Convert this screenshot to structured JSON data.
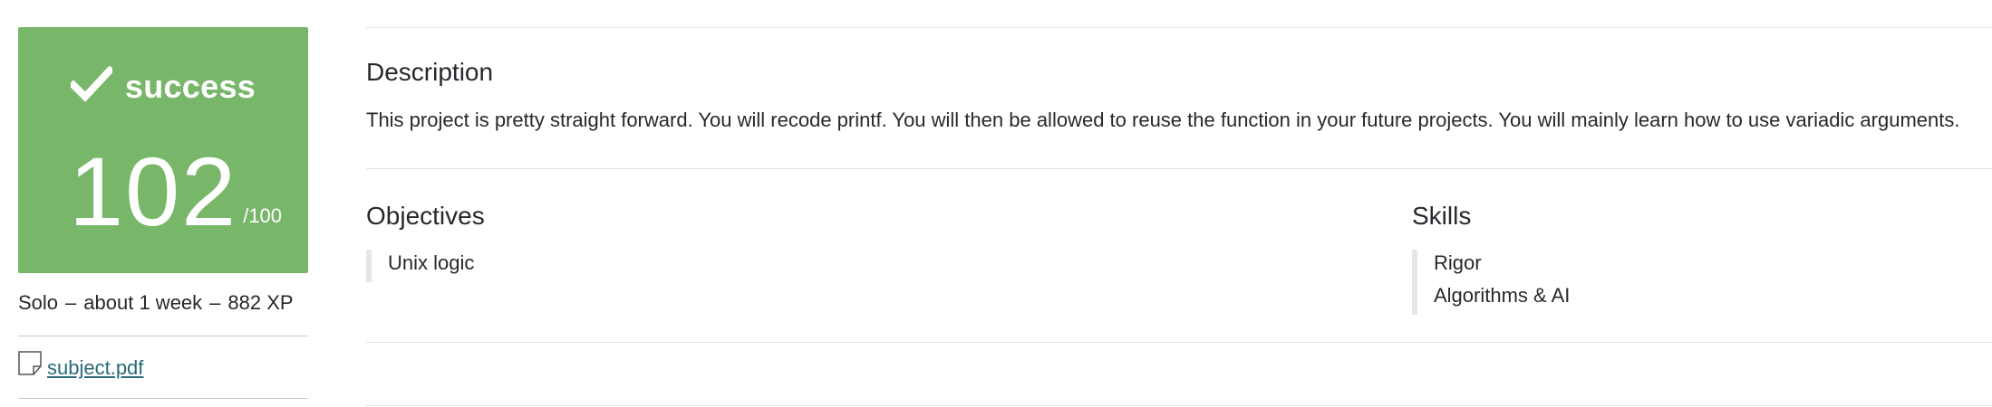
{
  "project": {
    "status": "success",
    "score": "102",
    "score_max": "/100",
    "status_color": "#78b76a",
    "status_icon": "check-icon",
    "meta": {
      "mode": "Solo",
      "duration": "about 1 week",
      "xp": "882 XP"
    },
    "attachment": {
      "icon": "file-icon",
      "label": "subject.pdf"
    }
  },
  "description": {
    "title": "Description",
    "text": "This project is pretty straight forward. You will recode printf. You will then be allowed to reuse the function in your future projects. You will mainly learn how to use variadic arguments."
  },
  "objectives": {
    "title": "Objectives",
    "items": [
      "Unix logic"
    ]
  },
  "skills": {
    "title": "Skills",
    "items": [
      "Rigor",
      "Algorithms & AI"
    ]
  }
}
